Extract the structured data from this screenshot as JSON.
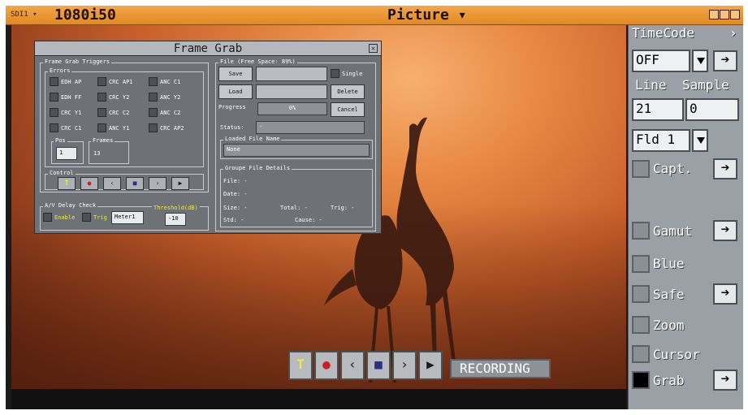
{
  "titlebar": {
    "sdi_label": "SDI1 ▾",
    "format": "1080i50",
    "view": "Picture ▾"
  },
  "panel": {
    "timecode_label": "TimeCode",
    "timecode_chevron": "›",
    "timecode_value": "OFF",
    "line_label": "Line",
    "sample_label": "Sample",
    "line_value": "21",
    "sample_value": "0",
    "field_value": "Fld 1",
    "arrow_glyph": "➔",
    "capt_label": "Capt.",
    "gamut_label": "Gamut",
    "blue_label": "Blue",
    "safe_label": "Safe",
    "zoom_label": "Zoom",
    "cursor_label": "Cursor",
    "grab_label": "Grab",
    "grab_checked": true
  },
  "dialog": {
    "title": "Frame Grab",
    "close_glyph": "✕",
    "triggers_label": "Frame Grab Triggers",
    "errors_label": "Errors",
    "errors": [
      [
        "EDH AP",
        "CRC AP1",
        "ANC C1"
      ],
      [
        "EDH FF",
        "CRC Y2",
        "ANC Y2"
      ],
      [
        "CRC Y1",
        "CRC C2",
        "ANC C2"
      ],
      [
        "CRC C1",
        "ANC Y1",
        "CRC AP2"
      ]
    ],
    "pos_label": "Pos",
    "pos_value": "1",
    "frames_label": "Frames",
    "frames_value": "13",
    "control_label": "Control",
    "av_label": "A/V Delay Check",
    "enable_label": "Enable",
    "trig_label": "Trig",
    "meter_value": "Meter1",
    "threshold_label": "Threshold(dB)",
    "threshold_value": "-10",
    "file_label": "File (Free Space: 89%)",
    "save_label": "Save",
    "single_label": "Single",
    "load_label": "Load",
    "delete_label": "Delete",
    "progress_label": "Progress",
    "progress_value": "0%",
    "cancel_label": "Cancel",
    "status_label": "Status:",
    "status_value": "-",
    "loaded_file_label": "Loaded File Name",
    "loaded_file_value": "None",
    "details_label": "Groupe File Details",
    "file_row": "File: -",
    "date_row": "Date: -",
    "size_row": "Size: -",
    "total_row": "Total: -",
    "trig_row": "Trig: -",
    "std_row": "Std: -",
    "cause_row": "Cause: -"
  },
  "transport": {
    "recording_label": "RECORDING"
  },
  "colors": {
    "title_orange": "#e99a36",
    "panel_gray": "#9aa0a5",
    "record_red": "#d21c1c",
    "text_yellow": "#f2e93a",
    "stop_blue": "#2a2f8a"
  }
}
